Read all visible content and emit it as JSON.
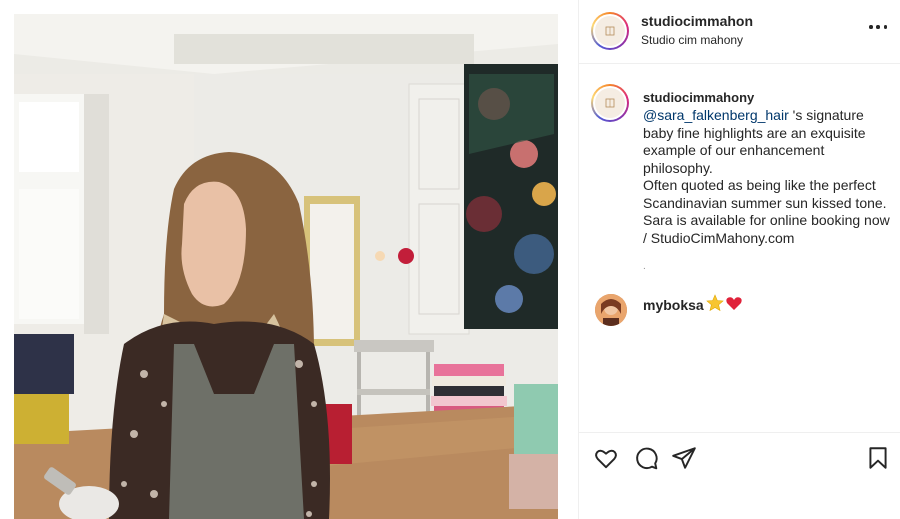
{
  "post": {
    "username": "studiocimmahon",
    "location": "Studio cim mahony",
    "more_icon": "more-horizontal-icon"
  },
  "caption": {
    "username": "studiocimmahony",
    "mention": "@sara_falkenberg_hair",
    "lines": [
      " 's signature",
      "baby fine highlights are an exquisite",
      "example of our enhancement",
      "philosophy.",
      "Often quoted as being like the perfect",
      "Scandinavian summer sun kissed tone.",
      "Sara is available for online booking now",
      "/ StudioCimMahony.com"
    ],
    "separator": "."
  },
  "comment": {
    "username": "myboksa",
    "emojis": "⭐❤️"
  },
  "actions": {
    "like_icon": "heart-icon",
    "comment_icon": "comment-icon",
    "share_icon": "paper-plane-icon",
    "save_icon": "bookmark-icon"
  },
  "colors": {
    "mention": "#00376b",
    "text": "#262626",
    "border": "#efefef"
  }
}
